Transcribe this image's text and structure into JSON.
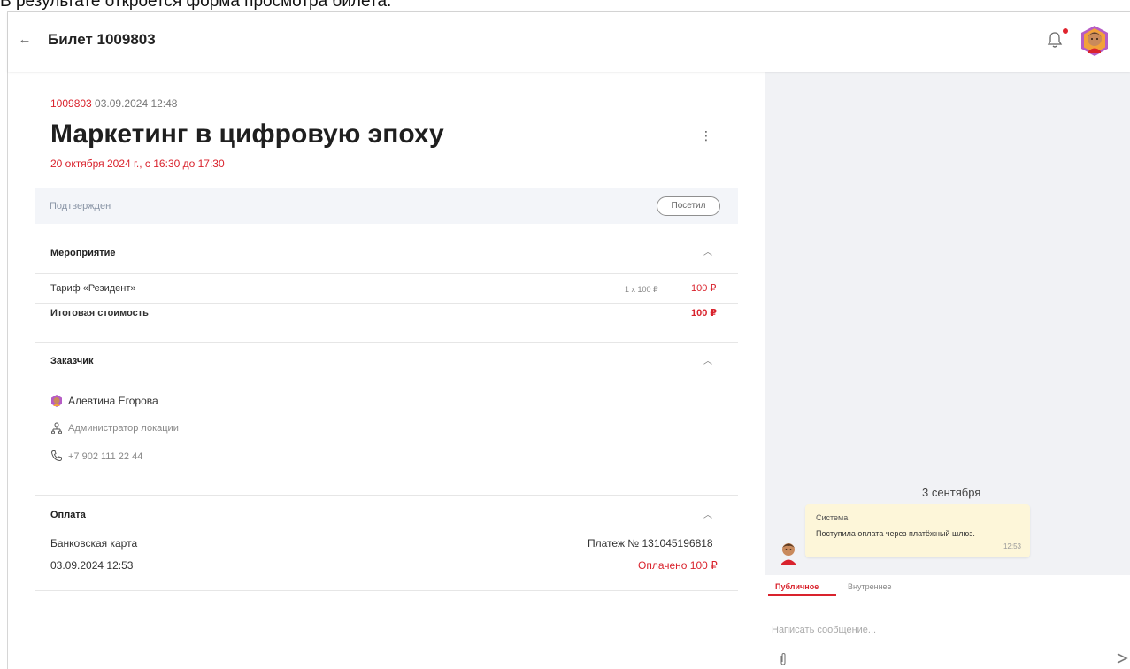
{
  "caption": "В результате откроется форма просмотра билета:",
  "header": {
    "title": "Билет 1009803",
    "back_icon": "arrow-left-icon",
    "notification_icon": "bell-icon",
    "avatar_icon": "user-avatar-icon"
  },
  "ticket": {
    "number": "1009803",
    "created": " 03.09.2024 12:48",
    "title": "Маркетинг в цифровую эпоху",
    "date": "20 октября 2024 г., с 16:30 до 17:30",
    "status": "Подтвержден",
    "visited_button": "Посетил",
    "menu_icon": "more-vertical-icon"
  },
  "event_section": {
    "title": "Мероприятие",
    "tariff": "Тариф «Резидент»",
    "quantity": "1 x 100 ₽",
    "price": "100 ₽",
    "total_label": "Итоговая стоимость",
    "total_value": "100 ₽"
  },
  "customer_section": {
    "title": "Заказчик",
    "name": "Алевтина Егорова",
    "role": "Администратор локации",
    "phone": "+7 902 111 22 44"
  },
  "payment_section": {
    "title": "Оплата",
    "method": "Банковская карта",
    "payment_no": "Платеж № 131045196818",
    "date": "03.09.2024 12:53",
    "status": "Оплачено 100 ₽"
  },
  "chat": {
    "date_separator": "3 сентября",
    "message": {
      "sender": "Система",
      "text": "Поступила оплата через платёжный шлюз.",
      "time": "12:53"
    },
    "tabs": [
      "Публичное",
      "Внутреннее"
    ],
    "input_placeholder": "Написать сообщение...",
    "attach_icon": "paperclip-icon",
    "send_icon": "send-icon"
  },
  "colors": {
    "accent": "#d9232d",
    "panel_bg": "#f1f2f5",
    "status_bar_bg": "#f3f5f9",
    "bubble_bg": "#fdf6d9"
  }
}
